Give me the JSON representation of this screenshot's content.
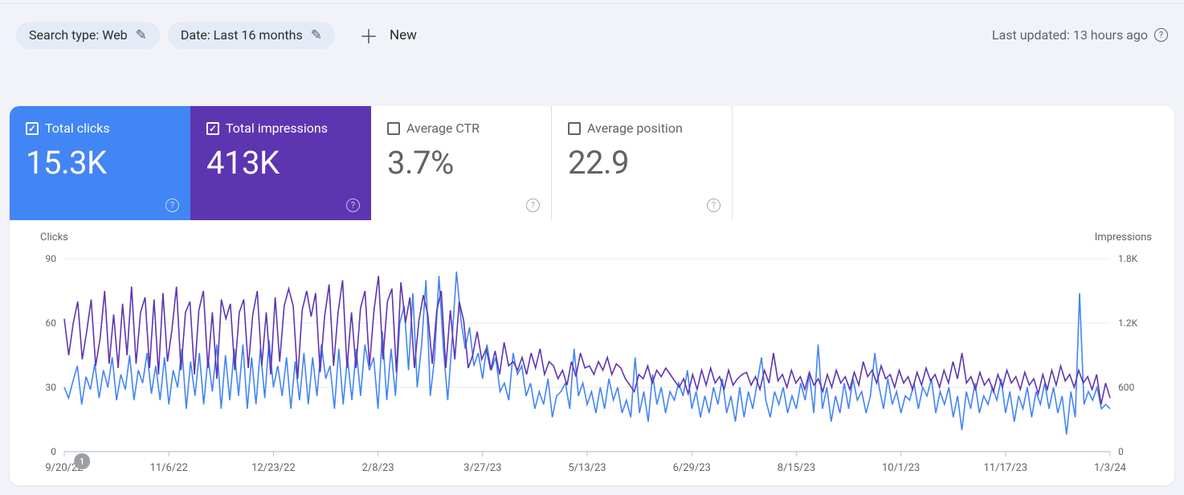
{
  "filters": {
    "search_type": "Search type: Web",
    "date_range": "Date: Last 16 months",
    "new_label": "New"
  },
  "last_updated": "Last updated: 13 hours ago",
  "metrics": {
    "clicks": {
      "label": "Total clicks",
      "value": "15.3K",
      "active": true,
      "color": "#4285f4"
    },
    "impressions": {
      "label": "Total impressions",
      "value": "413K",
      "active": true,
      "color": "#5e35b1"
    },
    "ctr": {
      "label": "Average CTR",
      "value": "3.7%",
      "active": false
    },
    "position": {
      "label": "Average position",
      "value": "22.9",
      "active": false
    }
  },
  "chart_data": {
    "type": "line",
    "x_dates": [
      "9/20/22",
      "11/6/22",
      "12/23/22",
      "2/8/23",
      "3/27/23",
      "5/13/23",
      "6/29/23",
      "8/15/23",
      "10/1/23",
      "11/17/23",
      "1/3/24"
    ],
    "left_axis": {
      "label": "Clicks",
      "ticks": [
        0,
        30,
        60,
        90
      ],
      "range": [
        0,
        90
      ]
    },
    "right_axis": {
      "label": "Impressions",
      "ticks": [
        0,
        600,
        1200,
        1800
      ],
      "range": [
        0,
        1800
      ]
    },
    "series": [
      {
        "name": "Clicks",
        "axis": "left",
        "color": "#4285f4",
        "values": [
          30,
          25,
          33,
          40,
          22,
          35,
          29,
          41,
          25,
          38,
          30,
          44,
          24,
          36,
          29,
          45,
          24,
          38,
          32,
          46,
          27,
          40,
          24,
          44,
          22,
          38,
          30,
          48,
          20,
          42,
          26,
          46,
          22,
          44,
          28,
          50,
          20,
          45,
          24,
          48,
          26,
          50,
          20,
          44,
          22,
          48,
          25,
          52,
          30,
          40,
          26,
          44,
          20,
          42,
          24,
          46,
          22,
          44,
          26,
          50,
          34,
          40,
          20,
          48,
          22,
          44,
          24,
          48,
          26,
          50,
          38,
          44,
          20,
          56,
          24,
          48,
          26,
          60,
          68,
          38,
          74,
          30,
          50,
          80,
          26,
          44,
          82,
          48,
          24,
          52,
          84,
          62,
          48,
          58,
          40,
          46,
          34,
          50,
          38,
          44,
          28,
          32,
          24,
          46,
          36,
          40,
          26,
          32,
          20,
          28,
          22,
          34,
          16,
          26,
          28,
          32,
          20,
          48,
          26,
          32,
          22,
          28,
          18,
          30,
          20,
          34,
          24,
          30,
          18,
          24,
          16,
          44,
          18,
          28,
          14,
          36,
          22,
          30,
          18,
          28,
          24,
          32,
          26,
          38,
          20,
          28,
          16,
          26,
          18,
          30,
          22,
          34,
          18,
          26,
          14,
          30,
          16,
          28,
          20,
          32,
          44,
          24,
          16,
          28,
          22,
          30,
          18,
          26,
          20,
          32,
          24,
          36,
          18,
          50,
          20,
          30,
          14,
          26,
          18,
          32,
          20,
          34,
          24,
          28,
          18,
          26,
          46,
          30,
          20,
          34,
          22,
          28,
          18,
          26,
          24,
          32,
          20,
          30,
          26,
          34,
          18,
          28,
          22,
          30,
          16,
          26,
          10,
          28,
          20,
          32,
          18,
          26,
          22,
          30,
          24,
          34,
          18,
          28,
          14,
          26,
          20,
          30,
          16,
          28,
          22,
          32,
          20,
          30,
          18,
          26,
          8,
          28,
          16,
          74,
          22,
          28,
          24,
          30,
          20,
          22,
          20
        ]
      },
      {
        "name": "Impressions",
        "axis": "right",
        "color": "#5e35b1",
        "values": [
          1240,
          900,
          1200,
          1400,
          860,
          1120,
          1420,
          800,
          1060,
          1500,
          820,
          1280,
          780,
          1380,
          900,
          1540,
          820,
          1300,
          1440,
          780,
          1420,
          720,
          1480,
          840,
          1140,
          1540,
          760,
          1300,
          1400,
          720,
          1320,
          1500,
          780,
          1300,
          680,
          1420,
          1240,
          1380,
          760,
          1300,
          1420,
          780,
          1280,
          1500,
          800,
          1300,
          720,
          1440,
          840,
          1360,
          1520,
          1360,
          680,
          1320,
          1500,
          1260,
          1480,
          740,
          1260,
          1560,
          800,
          1300,
          1600,
          780,
          1300,
          780,
          1340,
          1500,
          800,
          1320,
          1640,
          860,
          1400,
          1520,
          740,
          1580,
          1200,
          1440,
          780,
          1220,
          1460,
          1280,
          820,
          1320,
          1500,
          780,
          1320,
          860,
          1400,
          1220,
          780,
          900,
          1120,
          860,
          960,
          760,
          940,
          720,
          1020,
          800,
          840,
          760,
          880,
          720,
          920,
          780,
          960,
          720,
          840,
          800,
          680,
          760,
          620,
          840,
          700,
          920,
          780,
          800,
          720,
          840,
          760,
          880,
          720,
          820,
          780,
          680,
          620,
          560,
          720,
          680,
          800,
          640,
          760,
          700,
          780,
          720,
          660,
          600,
          680,
          540,
          720,
          580,
          760,
          620,
          780,
          640,
          700,
          580,
          760,
          620,
          680,
          720,
          740,
          620,
          700,
          580,
          760,
          640,
          920,
          660,
          720,
          600,
          760,
          640,
          700,
          580,
          740,
          620,
          680,
          560,
          720,
          600,
          760,
          640,
          700,
          580,
          740,
          620,
          840,
          700,
          760,
          640,
          800,
          680,
          720,
          600,
          760,
          640,
          700,
          580,
          740,
          620,
          780,
          660,
          720,
          600,
          760,
          640,
          840,
          680,
          920,
          640,
          700,
          580,
          740,
          620,
          680,
          560,
          720,
          600,
          760,
          640,
          700,
          580,
          740,
          620,
          680,
          540,
          720,
          580,
          760,
          620,
          800,
          660,
          720,
          600,
          760,
          640,
          700,
          580,
          720,
          440,
          640,
          500
        ]
      }
    ],
    "marker": {
      "index_fraction": 0.017,
      "label": "1"
    }
  }
}
